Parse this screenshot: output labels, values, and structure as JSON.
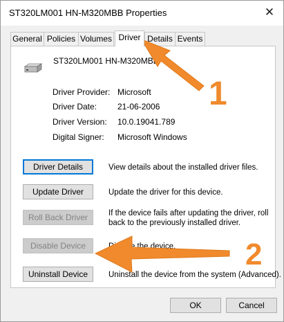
{
  "window": {
    "title": "ST320LM001 HN-M320MBB Properties",
    "close_glyph": "✕"
  },
  "tabs": [
    {
      "label": "General",
      "active": false
    },
    {
      "label": "Policies",
      "active": false
    },
    {
      "label": "Volumes",
      "active": false
    },
    {
      "label": "Driver",
      "active": true
    },
    {
      "label": "Details",
      "active": false
    },
    {
      "label": "Events",
      "active": false
    }
  ],
  "device": {
    "name": "ST320LM001 HN-M320MBB",
    "icon": "hard-drive-icon"
  },
  "driver_info": [
    {
      "label": "Driver Provider:",
      "value": "Microsoft"
    },
    {
      "label": "Driver Date:",
      "value": "21-06-2006"
    },
    {
      "label": "Driver Version:",
      "value": "10.0.19041.789"
    },
    {
      "label": "Digital Signer:",
      "value": "Microsoft Windows"
    }
  ],
  "actions": [
    {
      "button": "Driver Details",
      "description": "View details about the installed driver files.",
      "enabled": true,
      "focused": true
    },
    {
      "button": "Update Driver",
      "description": "Update the driver for this device.",
      "enabled": true,
      "focused": false
    },
    {
      "button": "Roll Back Driver",
      "description": "If the device fails after updating the driver, roll back to the previously installed driver.",
      "enabled": false,
      "focused": false
    },
    {
      "button": "Disable Device",
      "description": "Disable the device.",
      "enabled": false,
      "focused": false
    },
    {
      "button": "Uninstall Device",
      "description": "Uninstall the device from the system (Advanced).",
      "enabled": true,
      "focused": false
    }
  ],
  "footer": {
    "ok_label": "OK",
    "cancel_label": "Cancel"
  },
  "annotations": {
    "arrow1_label": "1",
    "arrow2_label": "2",
    "arrow_color": "#f08a2c"
  }
}
